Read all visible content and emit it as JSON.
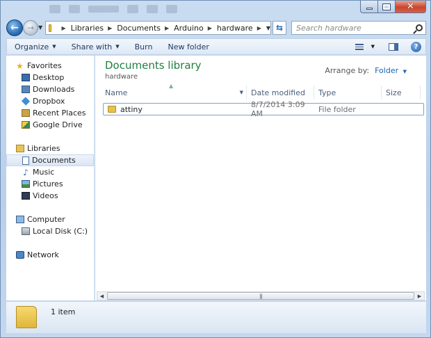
{
  "window": {
    "caption_buttons": [
      "minimize",
      "maximize",
      "close"
    ]
  },
  "address_bar": {
    "breadcrumbs": [
      "Libraries",
      "Documents",
      "Arduino",
      "hardware"
    ]
  },
  "search": {
    "placeholder": "Search hardware"
  },
  "toolbar": {
    "organize": "Organize",
    "share_with": "Share with",
    "burn": "Burn",
    "new_folder": "New folder"
  },
  "nav": {
    "favorites_label": "Favorites",
    "favorites": [
      "Desktop",
      "Downloads",
      "Dropbox",
      "Recent Places",
      "Google Drive"
    ],
    "libraries_label": "Libraries",
    "libraries": [
      "Documents",
      "Music",
      "Pictures",
      "Videos"
    ],
    "selected": "Documents",
    "computer_label": "Computer",
    "computer": [
      "Local Disk (C:)"
    ],
    "network_label": "Network"
  },
  "content": {
    "library_title": "Documents library",
    "library_subtitle": "hardware",
    "arrange_by_label": "Arrange by:",
    "arrange_by_value": "Folder",
    "columns": [
      "Name",
      "Date modified",
      "Type",
      "Size"
    ],
    "rows": [
      {
        "name": "attiny",
        "date_modified": "8/7/2014 3:09 AM",
        "type": "File folder",
        "size": ""
      }
    ]
  },
  "details": {
    "item_count": "1 item"
  },
  "colors": {
    "library_title": "#1e7f3e",
    "link_blue": "#1e63b8",
    "selection_border": "#7da2ce"
  }
}
